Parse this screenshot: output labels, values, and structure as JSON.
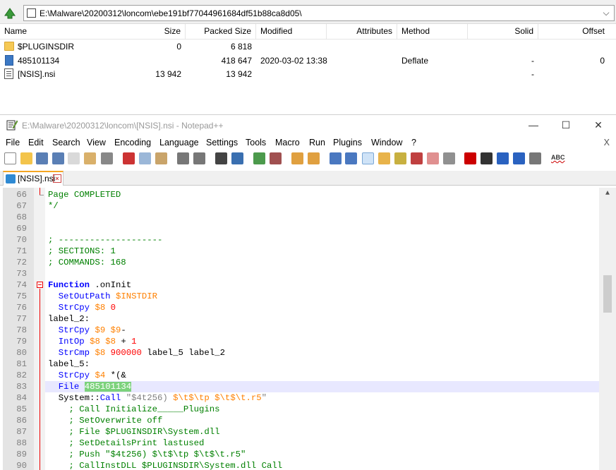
{
  "zip": {
    "path": "E:\\Malware\\20200312\\loncom\\ebe191bf77044961684df51b88ca8d05\\",
    "columns": [
      "Name",
      "Size",
      "Packed Size",
      "Modified",
      "Attributes",
      "Method",
      "Solid",
      "Offset"
    ],
    "rows": [
      {
        "name": "$PLUGINSDIR",
        "size": "0",
        "packed": "6 818",
        "modified": "",
        "attributes": "",
        "method": "",
        "solid": "",
        "offset": "",
        "icon": "folder-icon"
      },
      {
        "name": "485101134",
        "size": "",
        "packed": "418 647",
        "modified": "2020-03-02 13:38",
        "attributes": "",
        "method": "Deflate",
        "solid": "-",
        "offset": "0",
        "icon": "file-icon"
      },
      {
        "name": "[NSIS].nsi",
        "size": "13 942",
        "packed": "13 942",
        "modified": "",
        "attributes": "",
        "method": "",
        "solid": "-",
        "offset": "",
        "icon": "nsi-file-icon"
      }
    ]
  },
  "npp": {
    "title": "E:\\Malware\\20200312\\loncom\\[NSIS].nsi - Notepad++",
    "menu": [
      "File",
      "Edit",
      "Search",
      "View",
      "Encoding",
      "Language",
      "Settings",
      "Tools",
      "Macro",
      "Run",
      "Plugins",
      "Window",
      "?"
    ],
    "menu_close": "X",
    "tab": "[NSIS].nsi",
    "lines": [
      {
        "n": "66",
        "html": "<span class=\"cm\">Page COMPLETED</span>"
      },
      {
        "n": "67",
        "html": "<span class=\"cm\">*/</span>"
      },
      {
        "n": "68",
        "html": ""
      },
      {
        "n": "69",
        "html": ""
      },
      {
        "n": "70",
        "html": "<span class=\"cm\">; --------------------</span>"
      },
      {
        "n": "71",
        "html": "<span class=\"cm\">; SECTIONS: 1</span>"
      },
      {
        "n": "72",
        "html": "<span class=\"cm\">; COMMANDS: 168</span>"
      },
      {
        "n": "73",
        "html": ""
      },
      {
        "n": "74",
        "html": "<span class=\"kw\"><b>Function</b></span> .onInit"
      },
      {
        "n": "75",
        "html": "  <span class=\"kw\">SetOutPath</span> <span class=\"var\">$INSTDIR</span>"
      },
      {
        "n": "76",
        "html": "  <span class=\"kw\">StrCpy</span> <span class=\"var\">$8</span> <span class=\"num\">0</span>"
      },
      {
        "n": "77",
        "html": "label_2:"
      },
      {
        "n": "78",
        "html": "  <span class=\"kw\">StrCpy</span> <span class=\"var\">$9</span> <span class=\"var\">$9</span>-"
      },
      {
        "n": "79",
        "html": "  <span class=\"kw\">IntOp</span> <span class=\"var\">$8</span> <span class=\"var\">$8</span> + <span class=\"num\">1</span>"
      },
      {
        "n": "80",
        "html": "  <span class=\"kw\">StrCmp</span> <span class=\"var\">$8</span> <span class=\"num\">900000</span> label_5 label_2"
      },
      {
        "n": "81",
        "html": "label_5:"
      },
      {
        "n": "82",
        "html": "  <span class=\"kw\">StrCpy</span> <span class=\"var\">$4</span> *(&amp;"
      },
      {
        "n": "83",
        "html": "  <span class=\"kw\">File</span> <span class=\"sel\">485101134</span>",
        "current": true
      },
      {
        "n": "84",
        "html": "  System::<span class=\"kw\">Call</span> <span class=\"str\">\"$4t256) <span class=\"var\">$\\t$\\tp $\\t$\\t.r5</span>\"</span>"
      },
      {
        "n": "85",
        "html": "    <span class=\"cm\">; Call Initialize_____Plugins</span>"
      },
      {
        "n": "86",
        "html": "    <span class=\"cm\">; SetOverwrite off</span>"
      },
      {
        "n": "87",
        "html": "    <span class=\"cm\">; File $PLUGINSDIR\\System.dll</span>"
      },
      {
        "n": "88",
        "html": "    <span class=\"cm\">; SetDetailsPrint lastused</span>"
      },
      {
        "n": "89",
        "html": "    <span class=\"cm\">; Push \"$4t256) $\\t$\\tp $\\t$\\t.r5\"</span>"
      },
      {
        "n": "90",
        "html": "    <span class=\"cm\">; CallInstDLL $PLUGINSDIR\\System.dll Call</span>"
      }
    ]
  },
  "colors": {
    "comment": "#008000",
    "keyword": "#0000ff",
    "variable": "#ff8000",
    "selection": "#7cd27c",
    "tab_accent": "#f5a623"
  }
}
